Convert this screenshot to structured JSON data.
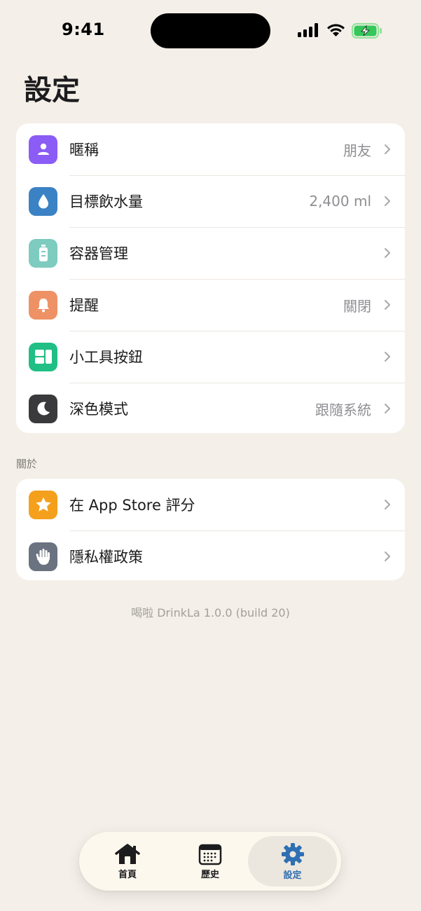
{
  "status_bar": {
    "time": "9:41"
  },
  "page_title": "設定",
  "settings": [
    {
      "label": "暱稱",
      "value": "朋友",
      "icon": "person-icon",
      "color": "#8B5CF6"
    },
    {
      "label": "目標飲水量",
      "value": "2,400 ml",
      "icon": "water-drop-icon",
      "color": "#3B82C4"
    },
    {
      "label": "容器管理",
      "value": "",
      "icon": "bottle-icon",
      "color": "#7ECBC0"
    },
    {
      "label": "提醒",
      "value": "關閉",
      "icon": "bell-icon",
      "color": "#EE9266"
    },
    {
      "label": "小工具按鈕",
      "value": "",
      "icon": "widget-icon",
      "color": "#1FBF85"
    },
    {
      "label": "深色模式",
      "value": "跟隨系統",
      "icon": "moon-icon",
      "color": "#3A3A3C"
    }
  ],
  "about_header": "關於",
  "about": [
    {
      "label": "在 App Store 評分",
      "icon": "star-icon",
      "color": "#F4A01C"
    },
    {
      "label": "隱私權政策",
      "icon": "hand-icon",
      "color": "#6B7280"
    }
  ],
  "version": "喝啦 DrinkLa 1.0.0 (build 20)",
  "tabs": [
    {
      "label": "首頁",
      "icon": "home-icon"
    },
    {
      "label": "歷史",
      "icon": "calendar-icon"
    },
    {
      "label": "設定",
      "icon": "gear-icon",
      "selected": true
    }
  ]
}
